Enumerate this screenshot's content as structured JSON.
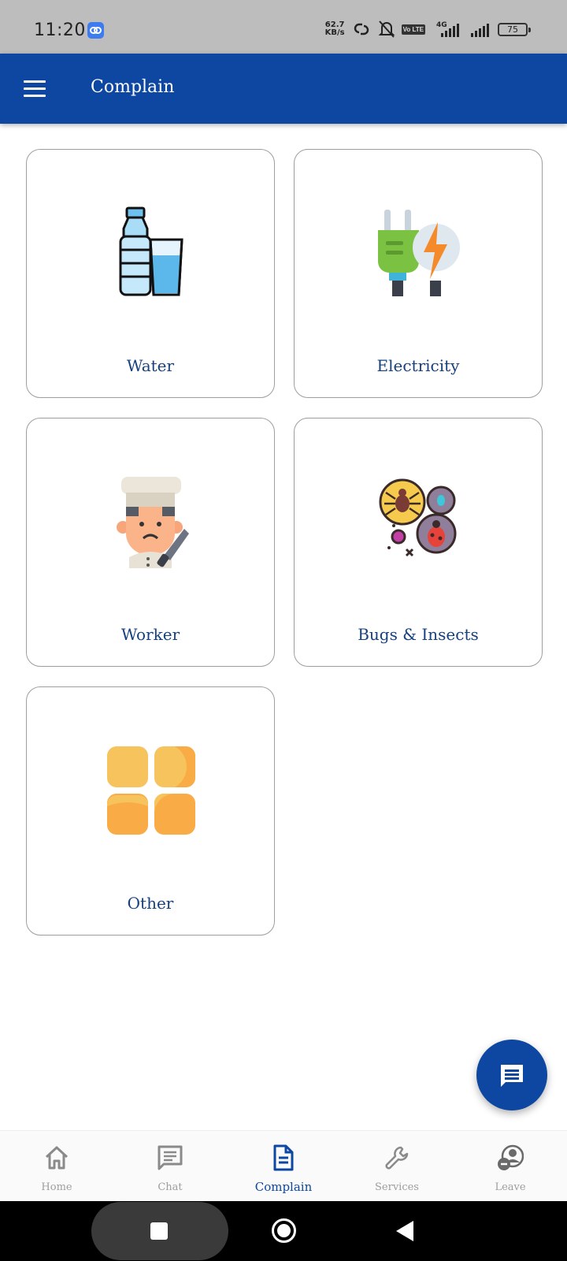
{
  "status_bar": {
    "time": "11:20",
    "speed_value": "62.7",
    "speed_unit": "KB/s",
    "volte": "Vo LTE",
    "network": "4G",
    "battery": "75"
  },
  "app_bar": {
    "title": "Complain",
    "menu_icon": "hamburger-menu-icon"
  },
  "categories": [
    {
      "label": "Water",
      "icon": "water-bottle-glass-icon"
    },
    {
      "label": "Electricity",
      "icon": "plug-lightning-icon"
    },
    {
      "label": "Worker",
      "icon": "chef-worker-icon"
    },
    {
      "label": "Bugs & Insects",
      "icon": "bugs-insects-icon"
    },
    {
      "label": "Other",
      "icon": "grid-squares-icon"
    }
  ],
  "fab": {
    "icon": "chat-message-icon"
  },
  "bottom_nav": [
    {
      "label": "Home",
      "icon": "home-icon",
      "active": false
    },
    {
      "label": "Chat",
      "icon": "chat-icon",
      "active": false
    },
    {
      "label": "Complain",
      "icon": "document-icon",
      "active": true
    },
    {
      "label": "Services",
      "icon": "wrench-icon",
      "active": false
    },
    {
      "label": "Leave",
      "icon": "user-minus-icon",
      "active": false
    }
  ],
  "colors": {
    "primary": "#0d47a1",
    "label_text": "#16407f",
    "inactive_nav": "#9e9e9e",
    "status_bar_bg": "#bdbdbd"
  }
}
